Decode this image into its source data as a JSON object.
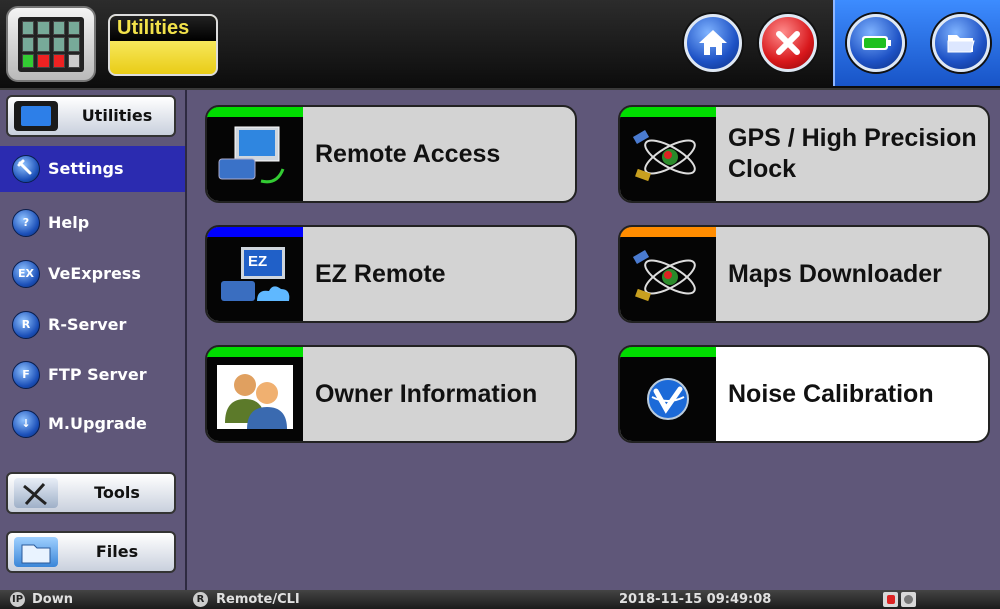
{
  "header": {
    "title": "Utilities",
    "buttons": [
      {
        "name": "home",
        "icon": "home-icon"
      },
      {
        "name": "close",
        "icon": "close-icon"
      },
      {
        "name": "battery",
        "icon": "battery-icon"
      },
      {
        "name": "folder",
        "icon": "folder-icon"
      }
    ]
  },
  "sidebar": {
    "utilities_tab": "Utilities",
    "items": [
      {
        "label": "Settings",
        "icon": "settings-icon",
        "icon_text": "",
        "active": true
      },
      {
        "label": "Help",
        "icon": "help-icon",
        "icon_text": "?"
      },
      {
        "label": "VeExpress",
        "icon": "veexpress-icon",
        "icon_text": "EX"
      },
      {
        "label": "R-Server",
        "icon": "r-server-icon",
        "icon_text": "R"
      },
      {
        "label": "FTP Server",
        "icon": "ftp-server-icon",
        "icon_text": "F"
      },
      {
        "label": "M.Upgrade",
        "icon": "upgrade-icon",
        "icon_text": "↓"
      }
    ],
    "tools_tab": "Tools",
    "files_tab": "Files"
  },
  "tiles": [
    {
      "label": "Remote Access",
      "strip_color": "#00dd00",
      "icon": "remote-access-icon"
    },
    {
      "label": "GPS / High Precision Clock",
      "strip_color": "#00dd00",
      "icon": "satellite-icon"
    },
    {
      "label": "EZ Remote",
      "strip_color": "#0000ff",
      "icon": "ez-remote-icon"
    },
    {
      "label": "Maps Downloader",
      "strip_color": "#ff8c00",
      "icon": "satellite-icon"
    },
    {
      "label": "Owner Information",
      "strip_color": "#00dd00",
      "icon": "owner-icon"
    },
    {
      "label": "Noise Calibration",
      "strip_color": "#00dd00",
      "icon": "noise-calibration-icon"
    }
  ],
  "icon_text": {
    "ez": "EZ"
  },
  "status": {
    "ip_icon": "IP",
    "ip_status": "Down",
    "remote_icon": "R",
    "remote_status": "Remote/CLI",
    "datetime": "2018-11-15 09:49:08"
  },
  "colors": {
    "background": "#5f5779",
    "active_nav": "#2b2bb0",
    "title_accent": "#f2e24a"
  }
}
